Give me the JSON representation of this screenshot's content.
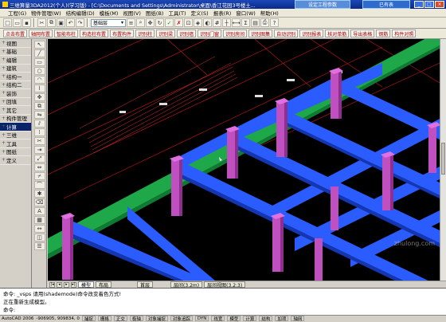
{
  "window": {
    "title": "三维算量3DA2012(个人)(学习版) - [C:\\Documents and Settings\\Administrator\\桌面\\香江花园3号楼土...",
    "float_button_left": "设定工程参数",
    "float_button_right": "已有表"
  },
  "menu": [
    "工程(G)",
    "物件管理(W)",
    "结构编辑(D)",
    "模板(M)",
    "视图(V)",
    "图纸(B)",
    "工具(T)",
    "定义(S)",
    "报表(R)",
    "窗口(W)",
    "帮助(H)"
  ],
  "toolbar_select": "基础层",
  "toolbar2": [
    "点击布置",
    "轴网布置",
    "智能布柱",
    "构造柱布置",
    "布置构件",
    "识别柱",
    "识别梁",
    "识别墙",
    "识别门窗",
    "识别房间",
    "识别图集",
    "自动识别",
    "识别报表",
    "核对单筋",
    "导出表格",
    "钢筋",
    "构件对照"
  ],
  "sidebar": [
    {
      "label": "视图",
      "active": false
    },
    {
      "label": "基础",
      "active": false
    },
    {
      "label": "编辑",
      "active": false
    },
    {
      "label": "建筑",
      "active": false
    },
    {
      "label": "结构一",
      "active": false
    },
    {
      "label": "结构二",
      "active": false
    },
    {
      "label": "装饰",
      "active": false
    },
    {
      "label": "回填",
      "active": false
    },
    {
      "label": "其它",
      "active": false
    },
    {
      "label": "构件管理",
      "active": false
    },
    {
      "label": "计算",
      "active": true
    },
    {
      "label": "三维",
      "active": false
    },
    {
      "label": "工具",
      "active": false
    },
    {
      "label": "图纸",
      "active": false
    },
    {
      "label": "定义",
      "active": false
    }
  ],
  "tabs": {
    "model": "模型",
    "layout1": "布局",
    "plan": "首层",
    "view_right": "层间(3.2m)",
    "view_tail": "层间视图(3.2:3)"
  },
  "command": {
    "line1": "命令: _vsps 请用(shademode)命令改变着色方式!",
    "line2": "正在重新生成模型。",
    "line3": "命令:"
  },
  "status": {
    "app": "AutoCAD 2006",
    "coords": "-906905, 909834, 0",
    "toggles": [
      "捕捉",
      "栅格",
      "正交",
      "极轴",
      "对象捕捉",
      "对象追踪",
      "DYN",
      "线宽",
      "模型"
    ],
    "right": [
      "计算",
      "结构",
      "加项",
      "轴网"
    ]
  },
  "watermark": "zhulong.com",
  "colors": {
    "beam": "#2b5cff",
    "column": "#c04fc0",
    "ground_beam": "#1aa84a",
    "red_line": "#cc0000",
    "grid": "#d02020"
  }
}
